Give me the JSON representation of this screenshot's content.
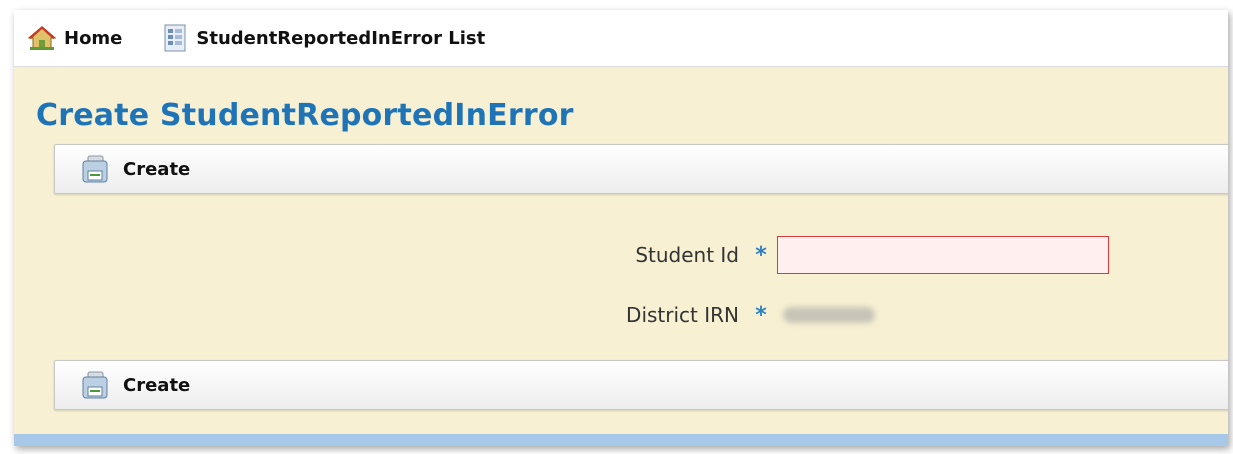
{
  "nav": {
    "home_label": "Home",
    "list_label": "StudentReportedInError List",
    "home_icon": "home-icon",
    "list_icon": "list-icon"
  },
  "page": {
    "title": "Create StudentReportedInError"
  },
  "toolbar": {
    "create_label_top": "Create",
    "create_label_bottom": "Create",
    "create_icon": "save-icon"
  },
  "form": {
    "student_id": {
      "label": "Student Id",
      "required_marker": "*",
      "value": ""
    },
    "district_irn": {
      "label": "District IRN",
      "required_marker": "*"
    }
  },
  "colors": {
    "title": "#1f74b8",
    "background": "#f7f0d2",
    "required": "#2b80c7",
    "error_border": "#dc3b3b",
    "error_fill": "#fff0ef"
  }
}
